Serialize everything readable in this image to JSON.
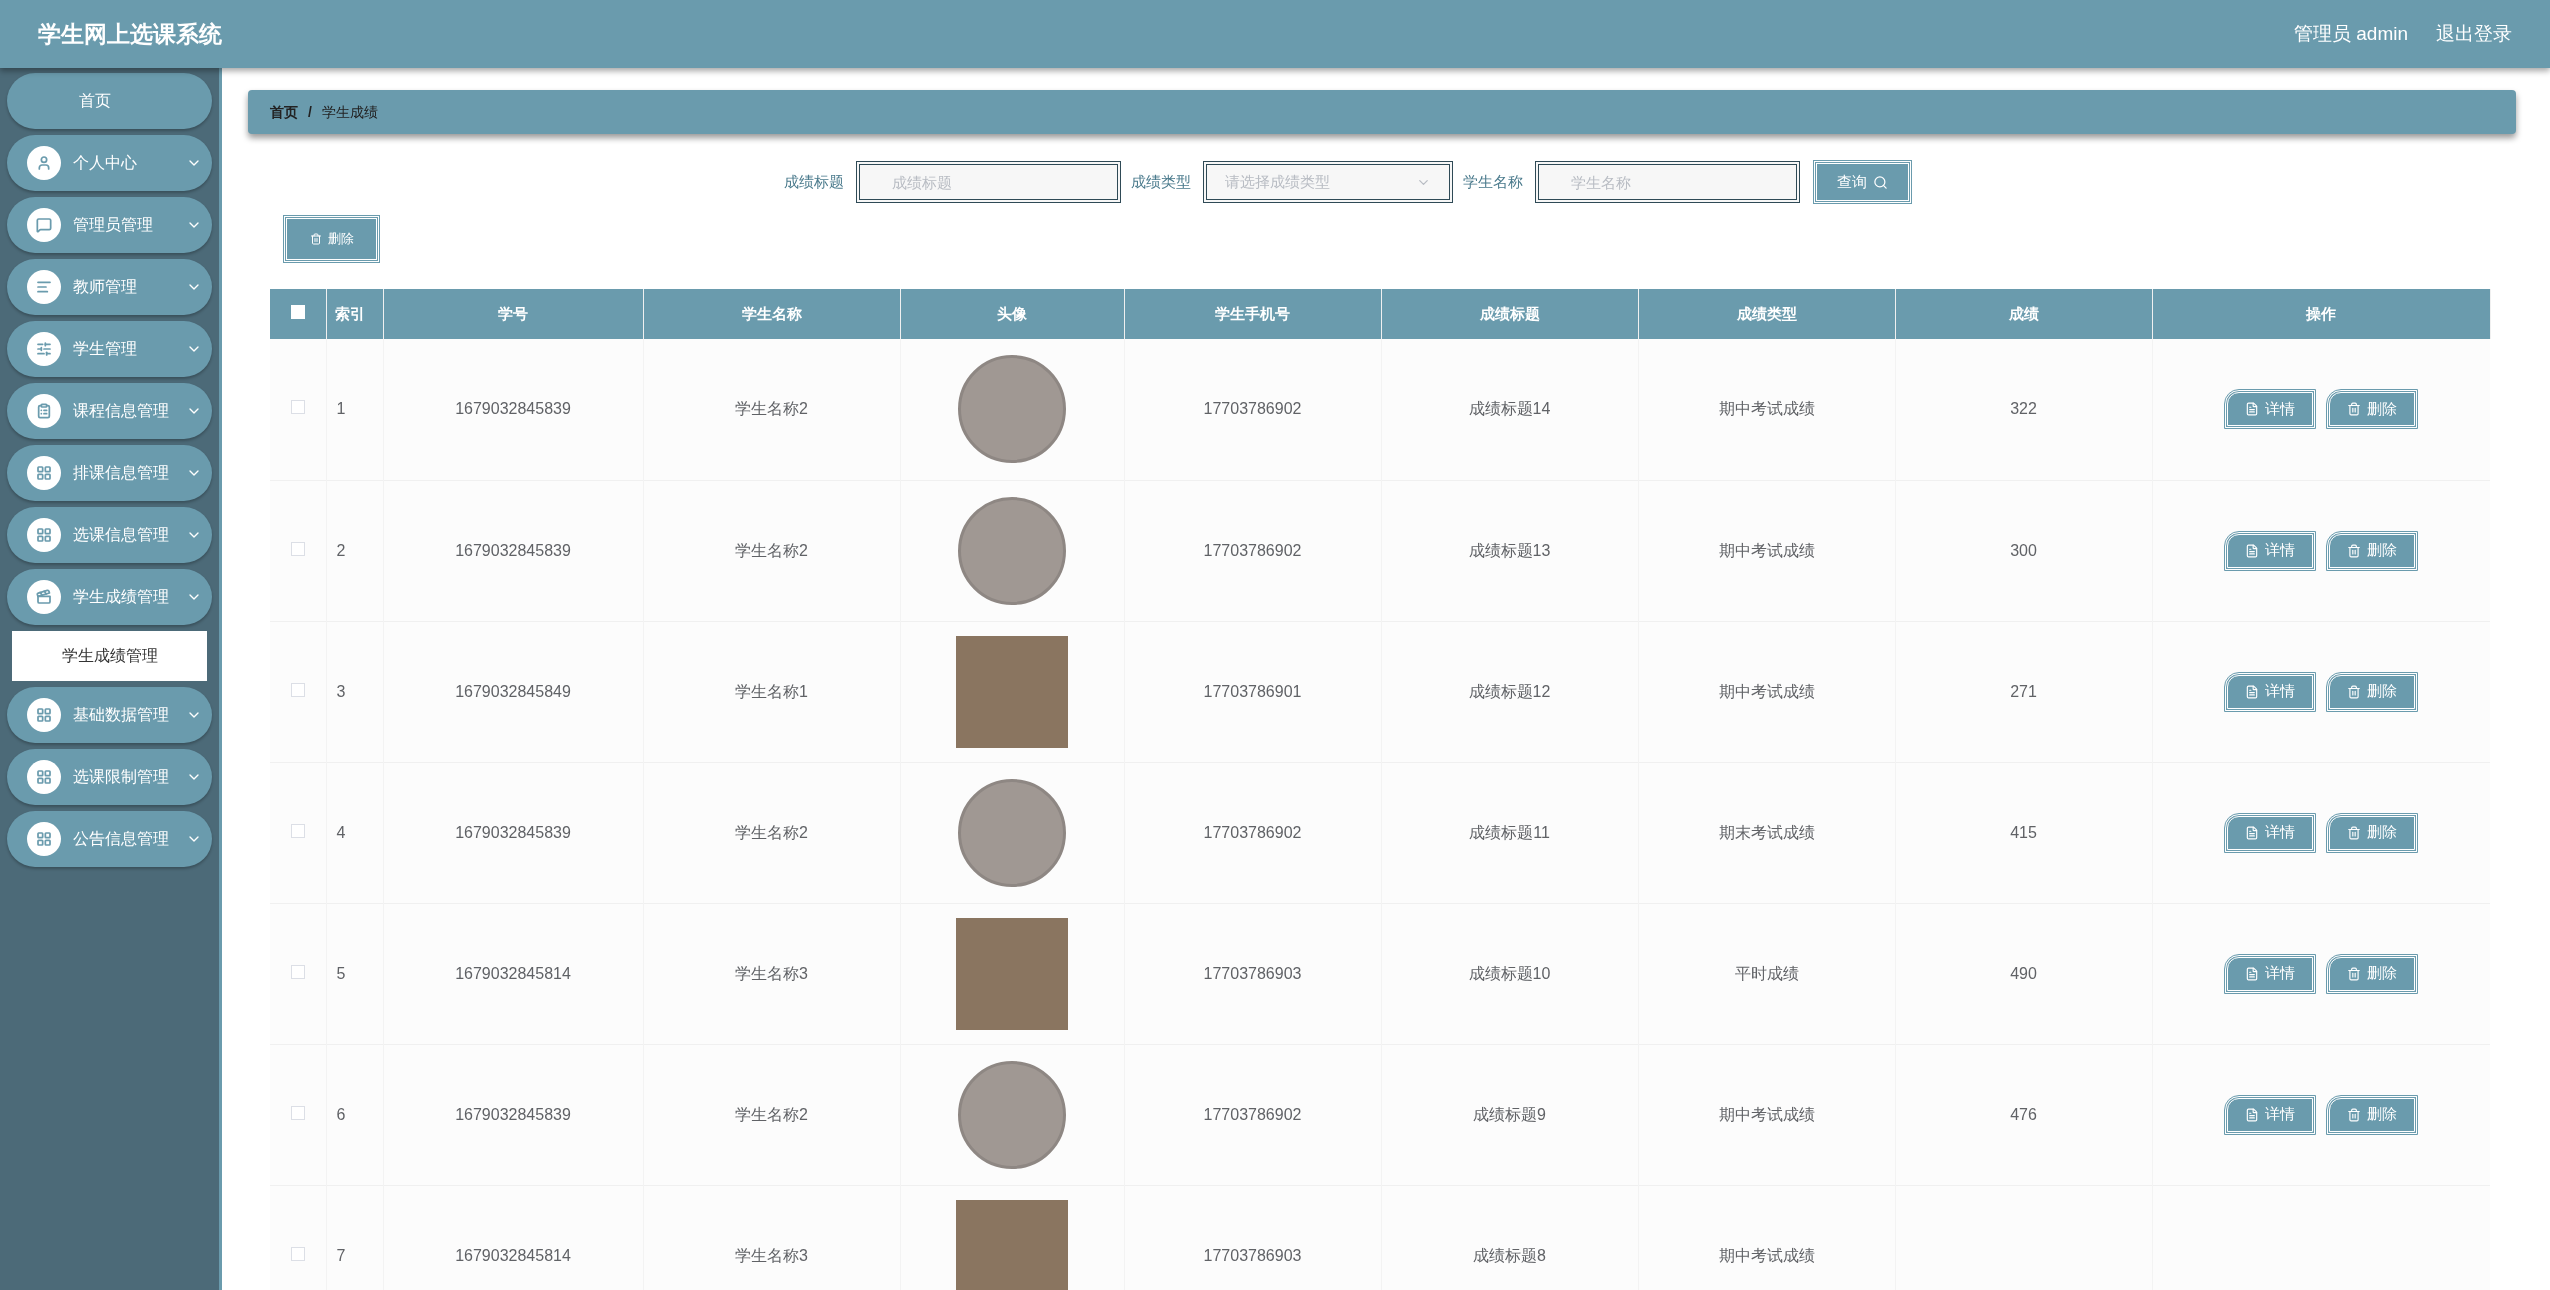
{
  "header": {
    "title": "学生网上选课系统",
    "user": "管理员 admin",
    "logout": "退出登录"
  },
  "sidebar": {
    "items": [
      {
        "label": "首页"
      },
      {
        "label": "个人中心"
      },
      {
        "label": "管理员管理"
      },
      {
        "label": "教师管理"
      },
      {
        "label": "学生管理"
      },
      {
        "label": "课程信息管理"
      },
      {
        "label": "排课信息管理"
      },
      {
        "label": "选课信息管理"
      },
      {
        "label": "学生成绩管理",
        "children": [
          {
            "label": "学生成绩管理",
            "selected": true
          }
        ]
      },
      {
        "label": "基础数据管理"
      },
      {
        "label": "选课限制管理"
      },
      {
        "label": "公告信息管理"
      }
    ]
  },
  "breadcrumb": {
    "items": [
      "首页",
      "学生成绩"
    ],
    "separator": "/"
  },
  "search": {
    "fields": [
      {
        "kind": "input",
        "label": "成绩标题",
        "placeholder": "成绩标题"
      },
      {
        "kind": "select",
        "label": "成绩类型",
        "placeholder": "请选择成绩类型"
      },
      {
        "kind": "input",
        "label": "学生名称",
        "placeholder": "学生名称"
      }
    ],
    "button": "查询"
  },
  "delete_button": "删除",
  "table": {
    "all_checked": false,
    "columns": [
      "索引",
      "学号",
      "学生名称",
      "头像",
      "学生手机号",
      "成绩标题",
      "成绩类型",
      "成绩",
      "操作"
    ],
    "rows": [
      {
        "checked": false,
        "index": "1",
        "student_no": "1679032845839",
        "name": "学生名称2",
        "avatar": {
          "kind": "round"
        },
        "phone": "17703786902",
        "title": "成绩标题14",
        "type": "期中考试成绩",
        "score": "322",
        "actions": [
          "详情",
          "删除"
        ]
      },
      {
        "checked": false,
        "index": "2",
        "student_no": "1679032845839",
        "name": "学生名称2",
        "avatar": {
          "kind": "round"
        },
        "phone": "17703786902",
        "title": "成绩标题13",
        "type": "期中考试成绩",
        "score": "300",
        "actions": [
          "详情",
          "删除"
        ]
      },
      {
        "checked": false,
        "index": "3",
        "student_no": "1679032845849",
        "name": "学生名称1",
        "avatar": {
          "kind": "square"
        },
        "phone": "17703786901",
        "title": "成绩标题12",
        "type": "期中考试成绩",
        "score": "271",
        "actions": [
          "详情",
          "删除"
        ]
      },
      {
        "checked": false,
        "index": "4",
        "student_no": "1679032845839",
        "name": "学生名称2",
        "avatar": {
          "kind": "round"
        },
        "phone": "17703786902",
        "title": "成绩标题11",
        "type": "期末考试成绩",
        "score": "415",
        "actions": [
          "详情",
          "删除"
        ]
      },
      {
        "checked": false,
        "index": "5",
        "student_no": "1679032845814",
        "name": "学生名称3",
        "avatar": {
          "kind": "square"
        },
        "phone": "17703786903",
        "title": "成绩标题10",
        "type": "平时成绩",
        "score": "490",
        "actions": [
          "详情",
          "删除"
        ]
      },
      {
        "checked": false,
        "index": "6",
        "student_no": "1679032845839",
        "name": "学生名称2",
        "avatar": {
          "kind": "round"
        },
        "phone": "17703786902",
        "title": "成绩标题9",
        "type": "期中考试成绩",
        "score": "476",
        "actions": [
          "详情",
          "删除"
        ]
      },
      {
        "checked": false,
        "index": "7",
        "student_no": "1679032845814",
        "name": "学生名称3",
        "avatar": {
          "kind": "square"
        },
        "phone": "17703786903",
        "title": "成绩标题8",
        "type": "期中考试成绩"
      }
    ]
  }
}
